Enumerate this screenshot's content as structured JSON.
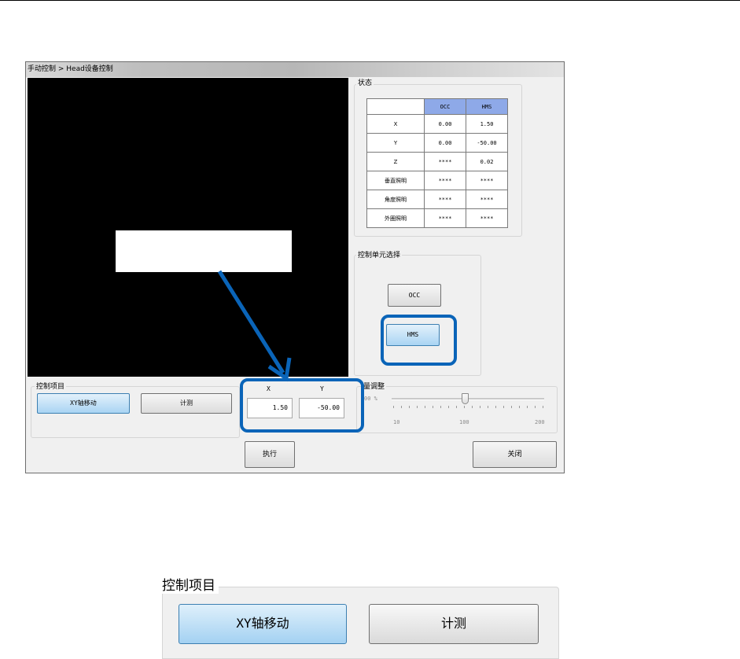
{
  "window": {
    "breadcrumb": "手动控制 > Head设备控制"
  },
  "status_group": {
    "label": "状态",
    "columns": [
      "OCC",
      "HMS"
    ],
    "rows": [
      {
        "label": "X",
        "occ": "0.00",
        "hms": "1.50"
      },
      {
        "label": "Y",
        "occ": "0.00",
        "hms": "-50.00"
      },
      {
        "label": "Z",
        "occ": "****",
        "hms": "0.02"
      },
      {
        "label": "垂直照明",
        "occ": "****",
        "hms": "****"
      },
      {
        "label": "角度照明",
        "occ": "****",
        "hms": "****"
      },
      {
        "label": "外圈照明",
        "occ": "****",
        "hms": "****"
      }
    ]
  },
  "unit_group": {
    "label": "控制单元选择",
    "occ_button": "OCC",
    "hms_button": "HMS",
    "selected": "HMS"
  },
  "control_group": {
    "label": "控制项目",
    "xy_button": "XY轴移动",
    "measure_button": "计测",
    "selected": "XY轴移动"
  },
  "xy_inputs": {
    "x_label": "X",
    "y_label": "Y",
    "x_value": "1.50",
    "y_value": "-50.00"
  },
  "light_group": {
    "label": "光量调整",
    "label_visible": "量调整",
    "value_text": "00 %",
    "min_label": "10",
    "mid_label": "100",
    "max_label": "200",
    "value": 100,
    "min": 10,
    "max": 200
  },
  "actions": {
    "execute_button": "执行",
    "close_button": "关闭"
  },
  "zoom_inset": {
    "label": "控制项目",
    "xy_button": "XY轴移动",
    "measure_button": "计测"
  },
  "colors": {
    "highlight": "#0a64b8",
    "selected_button": "#a9d4f3",
    "table_header": "#8ea9e8"
  }
}
